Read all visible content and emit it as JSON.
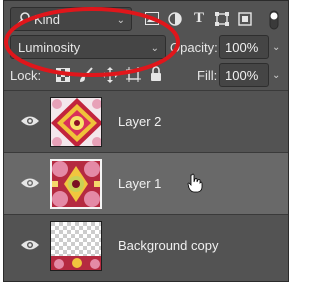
{
  "filter": {
    "kind_label": "Kind"
  },
  "blend": {
    "mode": "Luminosity",
    "opacity_label": "Opacity:",
    "opacity_value": "100%"
  },
  "lock": {
    "label": "Lock:",
    "fill_label": "Fill:",
    "fill_value": "100%"
  },
  "layers": [
    {
      "name": "Layer 2",
      "selected": false
    },
    {
      "name": "Layer 1",
      "selected": true
    },
    {
      "name": "Background copy",
      "selected": false
    }
  ],
  "colors": {
    "panel_bg": "#535353",
    "selected_row": "#696969",
    "highlight": "#e0161b"
  },
  "icons": [
    "search-icon",
    "image-filter-icon",
    "adjustment-filter-icon",
    "type-filter-icon",
    "shape-filter-icon",
    "smart-object-filter-icon",
    "filter-toggle-icon",
    "lock-transparent-icon",
    "lock-brush-icon",
    "lock-position-icon",
    "lock-artboard-icon",
    "lock-all-icon",
    "eye-icon",
    "pointer-hand-icon"
  ]
}
